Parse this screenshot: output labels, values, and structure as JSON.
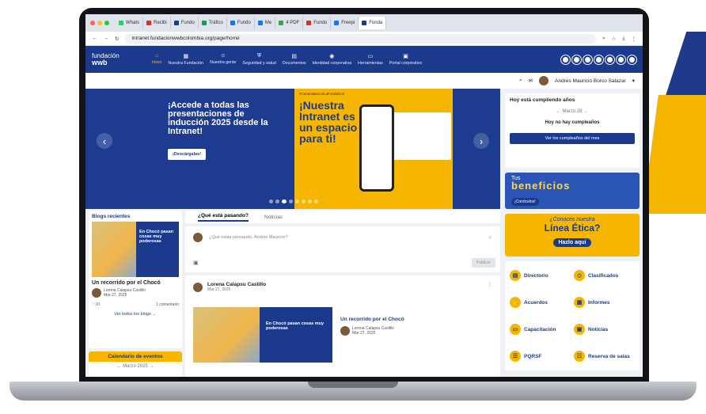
{
  "colors": {
    "brand_blue": "#1b3a8c",
    "brand_yellow": "#f6b600"
  },
  "browser": {
    "tabs": [
      "Whats",
      "Recibi",
      "Fundo",
      "Tráfico",
      "Fundo",
      "Me",
      "4 PDF",
      "Fundo",
      "Freepi",
      "Funda"
    ],
    "url": "intranet.fundacionwwbcolombia.org/page/home"
  },
  "nav": {
    "logo_top": "fundación",
    "logo_bottom": "wwb",
    "items": [
      {
        "icon": "home-icon",
        "label": "Inicio"
      },
      {
        "icon": "building-icon",
        "label": "Nuestra Fundación"
      },
      {
        "icon": "people-icon",
        "label": "Nuestra gente"
      },
      {
        "icon": "shield-icon",
        "label": "Seguridad y salud"
      },
      {
        "icon": "document-icon",
        "label": "Documentos"
      },
      {
        "icon": "id-icon",
        "label": "Identidad corporativa"
      },
      {
        "icon": "tools-icon",
        "label": "Herramientas"
      },
      {
        "icon": "portal-icon",
        "label": "Portal corporativo"
      }
    ]
  },
  "user": {
    "name": "Andres Mauricio Borco Salazar"
  },
  "banner": {
    "headline": "¡Accede a todas las presentaciones de inducción 2025 desde la Intranet!",
    "button": "¡Descárgalas!",
    "tagline": "#ConectateConLaFundacion",
    "yellow_headline": "¡Nuestra Intranet es un espacio para ti!"
  },
  "birthdays": {
    "title": "Hoy está cumpliendo años",
    "month": "Marzo 28",
    "empty": "Hoy no hay cumpleaños",
    "button": "Ver los cumpleaños del mes"
  },
  "promo_benefits": {
    "small": "Tus",
    "big": "beneficios",
    "cta": "¡Conócelos!"
  },
  "promo_ethics": {
    "small": "¿Conoces nuestra",
    "big": "Línea Ética?",
    "cta": "Hazlo aquí"
  },
  "quick_links": [
    {
      "icon": "directory-icon",
      "label": "Directorio"
    },
    {
      "icon": "tag-icon",
      "label": "Clasificados"
    },
    {
      "icon": "handshake-icon",
      "label": "Acuerdos"
    },
    {
      "icon": "report-icon",
      "label": "Informes"
    },
    {
      "icon": "laptop-icon",
      "label": "Capacitación"
    },
    {
      "icon": "news-icon",
      "label": "Noticias"
    },
    {
      "icon": "chat-icon",
      "label": "PQRSF"
    },
    {
      "icon": "room-icon",
      "label": "Reserva de salas"
    }
  ],
  "blogs": {
    "title": "Blogs recientes",
    "image_text": "En Chocó pasan cosas muy poderosas",
    "post_title": "Un recorrido por el Chocó",
    "author": "Lorena Calapsu Castillo",
    "date": "Mar 27, 2025",
    "likes": "10",
    "comments": "1 comentario",
    "all": "Ver todos los blogs"
  },
  "calendar": {
    "title": "Calendario de eventos",
    "month": "Marzo 2025"
  },
  "feed": {
    "tab_active": "¿Qué está pasando?",
    "tab_other": "Noticias",
    "placeholder": "¿Qué estás pensando, Andres Mauricio?",
    "publish": "Publicar",
    "post_author": "Lorena Calapsu Castillo",
    "post_date": "Mar 27, 2025",
    "image_text": "En Chocó pasan cosas muy poderosas",
    "post_title": "Un recorrido por el Chocó",
    "inner_author": "Lorena Calapsu Castillo",
    "inner_date": "Mar 27, 2025"
  }
}
